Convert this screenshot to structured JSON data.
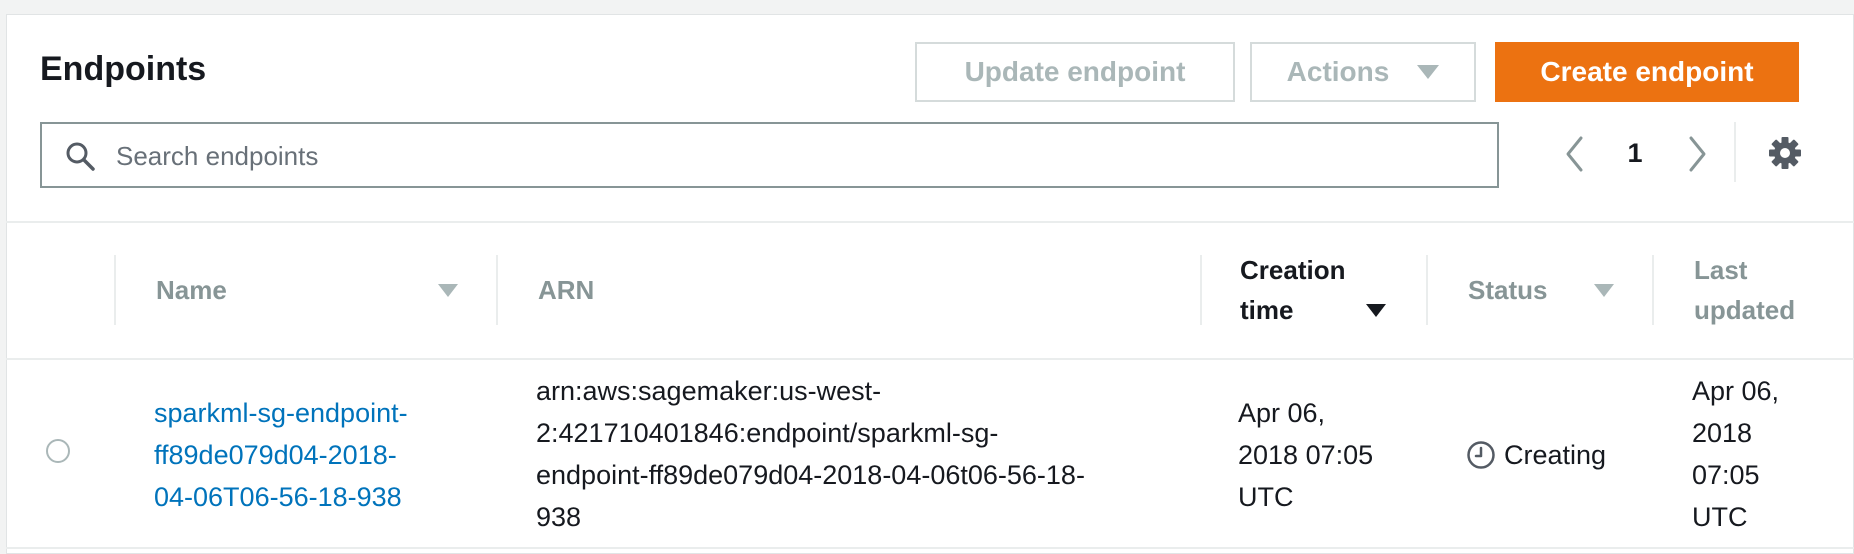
{
  "header": {
    "title": "Endpoints",
    "update_label": "Update endpoint",
    "actions_label": "Actions",
    "create_label": "Create endpoint"
  },
  "search": {
    "placeholder": "Search endpoints",
    "value": ""
  },
  "pagination": {
    "current_page": "1"
  },
  "table": {
    "columns": [
      {
        "key": "name",
        "lines": [
          "Name"
        ],
        "sortable": true,
        "active": false
      },
      {
        "key": "arn",
        "lines": [
          "ARN"
        ],
        "sortable": false,
        "active": false
      },
      {
        "key": "creation_time",
        "lines": [
          "Creation",
          "time"
        ],
        "sortable": true,
        "active": true
      },
      {
        "key": "status",
        "lines": [
          "Status"
        ],
        "sortable": true,
        "active": false
      },
      {
        "key": "last_updated",
        "lines": [
          "Last",
          "updated"
        ],
        "sortable": false,
        "active": false
      }
    ],
    "rows": [
      {
        "name": [
          "sparkml-sg-endpoint-",
          "ff89de079d04-2018-",
          "04-06T06-56-18-938"
        ],
        "arn": [
          "arn:aws:sagemaker:us-west-",
          "2:421710401846:endpoint/sparkml-sg-",
          "endpoint-ff89de079d04-2018-04-06t06-56-18-",
          "938"
        ],
        "creation_time": [
          "Apr 06,",
          "2018 07:05",
          "UTC"
        ],
        "status": "Creating",
        "last_updated": [
          "Apr 06,",
          "2018",
          "07:05",
          "UTC"
        ]
      }
    ]
  },
  "colors": {
    "accent": "#ec7211",
    "link": "#0073bb",
    "disabled_text": "#aab7b8",
    "header_text": "#879596"
  },
  "icons": {
    "search": "search-icon",
    "prev": "chevron-left-icon",
    "next": "chevron-right-icon",
    "settings": "gear-icon",
    "status": "clock-icon",
    "sort": "caret-down-icon"
  }
}
